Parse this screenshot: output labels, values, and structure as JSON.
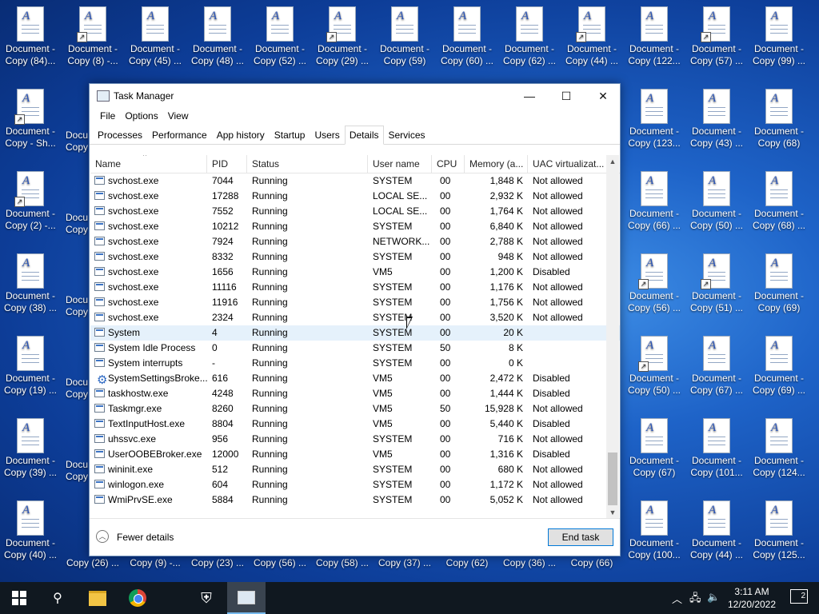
{
  "desktop": {
    "icons": [
      {
        "l1": "Document -",
        "l2": "Copy (84)...",
        "sc": false
      },
      {
        "l1": "Document -",
        "l2": "Copy (8) -...",
        "sc": true
      },
      {
        "l1": "Document -",
        "l2": "Copy (45) ...",
        "sc": false
      },
      {
        "l1": "Document -",
        "l2": "Copy (48) ...",
        "sc": false
      },
      {
        "l1": "Document -",
        "l2": "Copy (52) ...",
        "sc": false
      },
      {
        "l1": "Document -",
        "l2": "Copy (29) ...",
        "sc": true
      },
      {
        "l1": "Document -",
        "l2": "Copy (59)",
        "sc": false
      },
      {
        "l1": "Document -",
        "l2": "Copy (60) ...",
        "sc": false
      },
      {
        "l1": "Document -",
        "l2": "Copy (62) ...",
        "sc": false
      },
      {
        "l1": "Document -",
        "l2": "Copy (44) ...",
        "sc": true
      },
      {
        "l1": "Document -",
        "l2": "Copy (122...",
        "sc": false
      },
      {
        "l1": "Document -",
        "l2": "Copy (57) ...",
        "sc": true
      },
      {
        "l1": "Document -",
        "l2": "Copy (99) ...",
        "sc": false
      },
      {
        "l1": "Document -",
        "l2": "Copy - Sh...",
        "sc": true
      },
      {
        "l1": "Document -",
        "l2": "Copy (123...",
        "sc": false
      },
      {
        "l1": "Document -",
        "l2": "Copy (43) ...",
        "sc": false
      },
      {
        "l1": "Document -",
        "l2": "Copy (68)",
        "sc": false
      },
      {
        "l1": "Document -",
        "l2": "Copy (2) -...",
        "sc": true
      },
      {
        "l1": "Document -",
        "l2": "Copy (66) ...",
        "sc": false
      },
      {
        "l1": "Document -",
        "l2": "Copy (50) ...",
        "sc": false
      },
      {
        "l1": "Document -",
        "l2": "Copy (68) ...",
        "sc": false
      },
      {
        "l1": "Document -",
        "l2": "Copy (38) ...",
        "sc": false
      },
      {
        "l1": "Document -",
        "l2": "Copy (56) ...",
        "sc": true
      },
      {
        "l1": "Document -",
        "l2": "Copy (51) ...",
        "sc": true
      },
      {
        "l1": "Document -",
        "l2": "Copy (69)",
        "sc": false
      },
      {
        "l1": "Document -",
        "l2": "Copy (19) ...",
        "sc": false
      },
      {
        "l1": "Document -",
        "l2": "Copy (50) ...",
        "sc": true
      },
      {
        "l1": "Document -",
        "l2": "Copy (67) ...",
        "sc": false
      },
      {
        "l1": "Document -",
        "l2": "Copy (69) ...",
        "sc": false
      },
      {
        "l1": "Document -",
        "l2": "Copy (39) ...",
        "sc": false
      },
      {
        "l1": "Document -",
        "l2": "Copy (67)",
        "sc": false
      },
      {
        "l1": "Document -",
        "l2": "Copy (101...",
        "sc": false
      },
      {
        "l1": "Document -",
        "l2": "Copy (124...",
        "sc": false
      },
      {
        "l1": "Document -",
        "l2": "Copy (40) ...",
        "sc": false
      },
      {
        "l1": "Document -",
        "l2": "Copy (100...",
        "sc": false
      },
      {
        "l1": "Document -",
        "l2": "Copy (44) ...",
        "sc": false
      },
      {
        "l1": "Document -",
        "l2": "Copy (125...",
        "sc": false
      }
    ],
    "partial_labels": [
      {
        "text": "Docu",
        "sub": "Copy"
      },
      {
        "text": "Docu",
        "sub": "Copy"
      },
      {
        "text": "Docu",
        "sub": "Copy"
      },
      {
        "text": "Docu",
        "sub": "Copy"
      },
      {
        "text": "Docu",
        "sub": "Copy"
      }
    ],
    "bottom_row": [
      "Copy (26) ...",
      "Copy (9) -...",
      "Copy (23) ...",
      "Copy (56) ...",
      "Copy (58) ...",
      "Copy (37) ...",
      "Copy (62)",
      "Copy (36) ...",
      "Copy (66)"
    ]
  },
  "window": {
    "title": "Task Manager",
    "minimize": "—",
    "maximize": "☐",
    "close": "✕",
    "menu": [
      "File",
      "Options",
      "View"
    ],
    "tabs": [
      "Processes",
      "Performance",
      "App history",
      "Startup",
      "Users",
      "Details",
      "Services"
    ],
    "active_tab": "Details",
    "columns": [
      "Name",
      "PID",
      "Status",
      "User name",
      "CPU",
      "Memory (a...",
      "UAC virtualizat..."
    ],
    "rows": [
      {
        "name": "svchost.exe",
        "pid": "7044",
        "status": "Running",
        "user": "SYSTEM",
        "cpu": "00",
        "mem": "1,848 K",
        "uac": "Not allowed",
        "icon": "box"
      },
      {
        "name": "svchost.exe",
        "pid": "17288",
        "status": "Running",
        "user": "LOCAL SE...",
        "cpu": "00",
        "mem": "2,932 K",
        "uac": "Not allowed",
        "icon": "box"
      },
      {
        "name": "svchost.exe",
        "pid": "7552",
        "status": "Running",
        "user": "LOCAL SE...",
        "cpu": "00",
        "mem": "1,764 K",
        "uac": "Not allowed",
        "icon": "box"
      },
      {
        "name": "svchost.exe",
        "pid": "10212",
        "status": "Running",
        "user": "SYSTEM",
        "cpu": "00",
        "mem": "6,840 K",
        "uac": "Not allowed",
        "icon": "box"
      },
      {
        "name": "svchost.exe",
        "pid": "7924",
        "status": "Running",
        "user": "NETWORK...",
        "cpu": "00",
        "mem": "2,788 K",
        "uac": "Not allowed",
        "icon": "box"
      },
      {
        "name": "svchost.exe",
        "pid": "8332",
        "status": "Running",
        "user": "SYSTEM",
        "cpu": "00",
        "mem": "948 K",
        "uac": "Not allowed",
        "icon": "box"
      },
      {
        "name": "svchost.exe",
        "pid": "1656",
        "status": "Running",
        "user": "VM5",
        "cpu": "00",
        "mem": "1,200 K",
        "uac": "Disabled",
        "icon": "box"
      },
      {
        "name": "svchost.exe",
        "pid": "11116",
        "status": "Running",
        "user": "SYSTEM",
        "cpu": "00",
        "mem": "1,176 K",
        "uac": "Not allowed",
        "icon": "box"
      },
      {
        "name": "svchost.exe",
        "pid": "11916",
        "status": "Running",
        "user": "SYSTEM",
        "cpu": "00",
        "mem": "1,756 K",
        "uac": "Not allowed",
        "icon": "box"
      },
      {
        "name": "svchost.exe",
        "pid": "2324",
        "status": "Running",
        "user": "SYSTEM",
        "cpu": "00",
        "mem": "3,520 K",
        "uac": "Not allowed",
        "icon": "box"
      },
      {
        "name": "System",
        "pid": "4",
        "status": "Running",
        "user": "SYSTEM",
        "cpu": "00",
        "mem": "20 K",
        "uac": "",
        "icon": "box",
        "selected": true
      },
      {
        "name": "System Idle Process",
        "pid": "0",
        "status": "Running",
        "user": "SYSTEM",
        "cpu": "50",
        "mem": "8 K",
        "uac": "",
        "icon": "box"
      },
      {
        "name": "System interrupts",
        "pid": "-",
        "status": "Running",
        "user": "SYSTEM",
        "cpu": "00",
        "mem": "0 K",
        "uac": "",
        "icon": "box"
      },
      {
        "name": "SystemSettingsBroke...",
        "pid": "616",
        "status": "Running",
        "user": "VM5",
        "cpu": "00",
        "mem": "2,472 K",
        "uac": "Disabled",
        "icon": "gear"
      },
      {
        "name": "taskhostw.exe",
        "pid": "4248",
        "status": "Running",
        "user": "VM5",
        "cpu": "00",
        "mem": "1,444 K",
        "uac": "Disabled",
        "icon": "box"
      },
      {
        "name": "Taskmgr.exe",
        "pid": "8260",
        "status": "Running",
        "user": "VM5",
        "cpu": "50",
        "mem": "15,928 K",
        "uac": "Not allowed",
        "icon": "box"
      },
      {
        "name": "TextInputHost.exe",
        "pid": "8804",
        "status": "Running",
        "user": "VM5",
        "cpu": "00",
        "mem": "5,440 K",
        "uac": "Disabled",
        "icon": "box"
      },
      {
        "name": "uhssvc.exe",
        "pid": "956",
        "status": "Running",
        "user": "SYSTEM",
        "cpu": "00",
        "mem": "716 K",
        "uac": "Not allowed",
        "icon": "box"
      },
      {
        "name": "UserOOBEBroker.exe",
        "pid": "12000",
        "status": "Running",
        "user": "VM5",
        "cpu": "00",
        "mem": "1,316 K",
        "uac": "Disabled",
        "icon": "box"
      },
      {
        "name": "wininit.exe",
        "pid": "512",
        "status": "Running",
        "user": "SYSTEM",
        "cpu": "00",
        "mem": "680 K",
        "uac": "Not allowed",
        "icon": "box"
      },
      {
        "name": "winlogon.exe",
        "pid": "604",
        "status": "Running",
        "user": "SYSTEM",
        "cpu": "00",
        "mem": "1,172 K",
        "uac": "Not allowed",
        "icon": "box"
      },
      {
        "name": "WmiPrvSE.exe",
        "pid": "5884",
        "status": "Running",
        "user": "SYSTEM",
        "cpu": "00",
        "mem": "5,052 K",
        "uac": "Not allowed",
        "icon": "box"
      }
    ],
    "fewer_details": "Fewer details",
    "end_task": "End task"
  },
  "taskbar": {
    "time": "3:11 AM",
    "date": "12/20/2022",
    "notifications": "2",
    "icons": [
      "windows-start-icon",
      "search-icon",
      "file-explorer-icon",
      "chrome-icon",
      "security-shield-icon",
      "task-manager-icon"
    ]
  },
  "colors": {
    "accent": "#0078d7",
    "selected_row": "#e5f1fb",
    "taskbar": "#101820"
  }
}
